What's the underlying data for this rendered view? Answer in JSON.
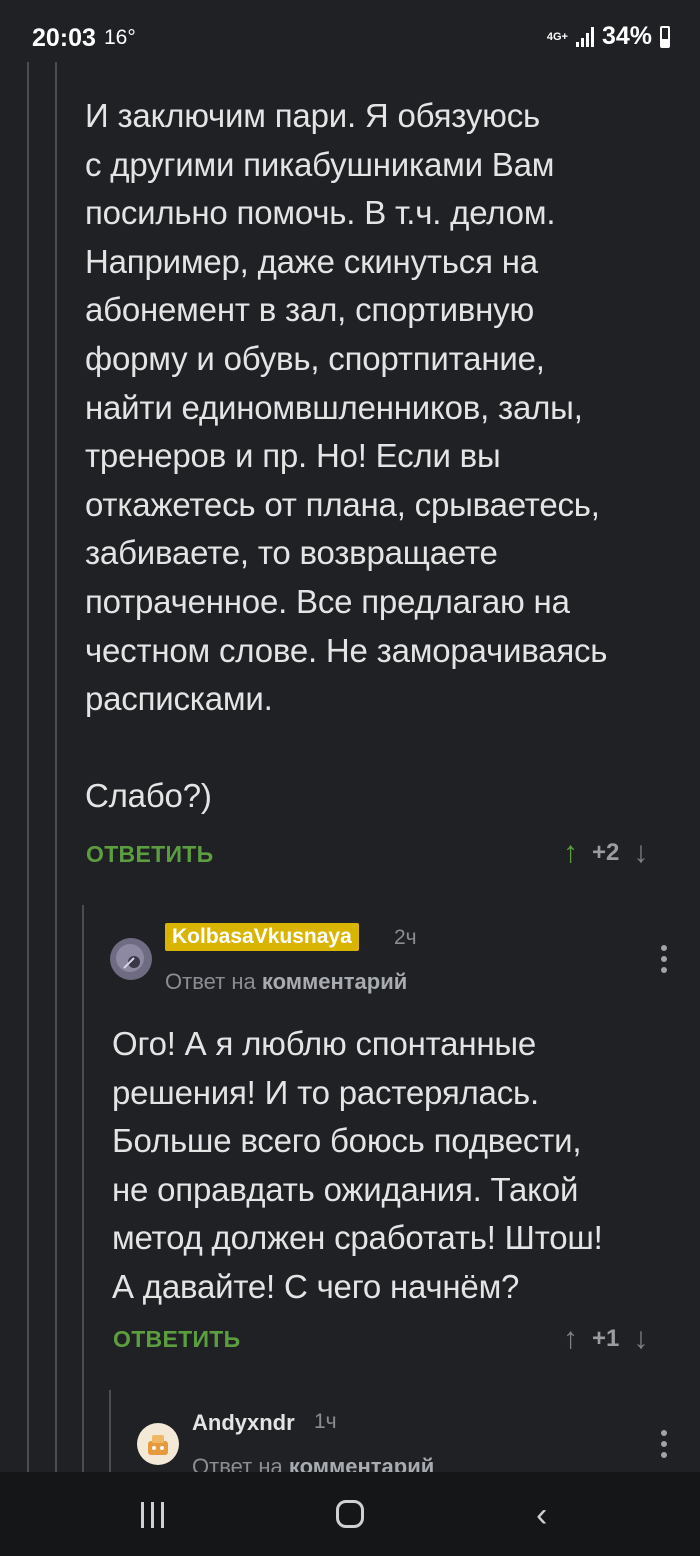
{
  "status_bar": {
    "time": "20:03",
    "temperature": "16°",
    "network": "4G+",
    "battery": "34%"
  },
  "comment_main": {
    "lines": [
      "И заключим пари. Я обязуюсь",
      "с другими пикабушниками Вам",
      "посильно помочь. В т.ч. делом.",
      "Например, даже скинуться на",
      "абонемент в зал, спортивную",
      "форму и обувь, спортпитание,",
      "найти единомвшленников, залы,",
      "тренеров и пр. Но! Если вы",
      "откажетесь от плана, срываетесь,",
      "забиваете, то возвращаете",
      "потраченное. Все предлагаю на",
      "честном слове. Не заморачиваясь",
      "расписками."
    ],
    "closing": "Слабо?)",
    "reply_label": "ОТВЕТИТЬ",
    "score": "+2"
  },
  "comment_reply1": {
    "username": "KolbasaVkusnaya",
    "time_ago": "2ч",
    "reply_prefix": "Ответ на",
    "reply_target": "комментарий",
    "lines": [
      "Ого! А я люблю спонтанные",
      "решения! И то растерялась.",
      "Больше всего боюсь подвести,",
      "не оправдать ожидания. Такой",
      "метод должен сработать! Штош!",
      "А давайте! С чего начнём?"
    ],
    "reply_label": "ОТВЕТИТЬ",
    "score": "+1"
  },
  "comment_reply2": {
    "username": "Andyxndr",
    "time_ago": "1ч",
    "reply_prefix": "Ответ на",
    "reply_target": "комментарий"
  },
  "colors": {
    "background": "#1f2125",
    "accent_green": "#5c9e3f",
    "badge_yellow": "#d9b400"
  }
}
